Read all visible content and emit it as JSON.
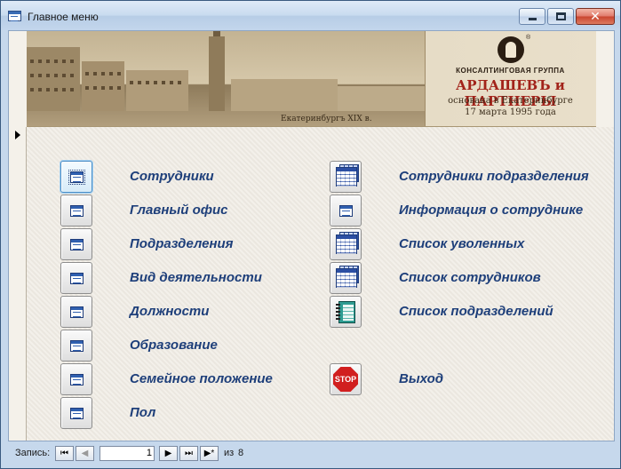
{
  "window": {
    "title": "Главное меню"
  },
  "banner": {
    "photo_caption": "Екатеринбургъ XIX в.",
    "company_line1": "КОНСАЛТИНГОВАЯ ГРУППА",
    "company_name": "АРДАШЕВЪ и ПАРТНЕРЫ",
    "founded_line1": "основана в Екатеринбурге",
    "founded_line2": "17 марта 1995 года",
    "registered_mark": "®"
  },
  "menu": {
    "left": [
      {
        "label": "Сотрудники",
        "icon": "form-icon"
      },
      {
        "label": "Главный офис",
        "icon": "form-icon"
      },
      {
        "label": "Подразделения",
        "icon": "form-icon"
      },
      {
        "label": "Вид деятельности",
        "icon": "form-icon"
      },
      {
        "label": "Должности",
        "icon": "form-icon"
      },
      {
        "label": "Образование",
        "icon": "form-icon"
      },
      {
        "label": "Семейное положение",
        "icon": "form-icon"
      },
      {
        "label": "Пол",
        "icon": "form-icon"
      }
    ],
    "right": [
      {
        "label": "Сотрудники подразделения",
        "icon": "datasheet-icon"
      },
      {
        "label": "Информация о сотруднике",
        "icon": "form-icon"
      },
      {
        "label": "Список уволенных",
        "icon": "datasheet-icon"
      },
      {
        "label": "Список сотрудников",
        "icon": "datasheet-icon"
      },
      {
        "label": "Список подразделений",
        "icon": "notebook-icon"
      },
      {
        "label": "Выход",
        "icon": "stop-icon"
      }
    ],
    "stop_text": "STOP"
  },
  "navigation": {
    "label": "Запись:",
    "first": "⏮",
    "prev": "◀",
    "current": "1",
    "next": "▶",
    "last": "⏭",
    "new": "▶*",
    "of_label": "из",
    "total": "8"
  },
  "colors": {
    "label_color": "#1e3f7a",
    "brand_red": "#a2231a",
    "window_frame": "#c6d8ec"
  }
}
